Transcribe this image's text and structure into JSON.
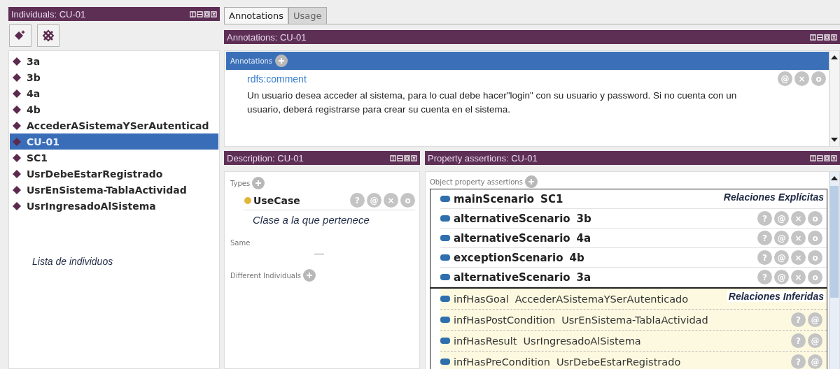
{
  "individuals": {
    "title": "Individuals: CU-01",
    "note": "Lista de individuos",
    "items": [
      {
        "label": "3a",
        "selected": false
      },
      {
        "label": "3b",
        "selected": false
      },
      {
        "label": "4a",
        "selected": false
      },
      {
        "label": "4b",
        "selected": false
      },
      {
        "label": "AccederASistemaYSerAutenticad",
        "selected": false
      },
      {
        "label": "CU-01",
        "selected": true
      },
      {
        "label": "SC1",
        "selected": false
      },
      {
        "label": "UsrDebeEstarRegistrado",
        "selected": false
      },
      {
        "label": "UsrEnSistema-TablaActividad",
        "selected": false
      },
      {
        "label": "UsrIngresadoAlSistema",
        "selected": false
      }
    ]
  },
  "tabs": [
    {
      "label": "Annotations",
      "selected": true
    },
    {
      "label": "Usage",
      "selected": false
    }
  ],
  "annotations": {
    "title": "Annotations: CU-01",
    "header": "Annotations",
    "property": "rdfs:comment",
    "actions": [
      "@",
      "×",
      "o"
    ],
    "text": "Un usuario desea acceder al sistema, para lo cual debe hacer\"login\" con su usuario y password. Si no cuenta con un usuario, deberá registrarse para crear su cuenta en el sistema."
  },
  "description": {
    "title": "Description: CU-01",
    "types_label": "Types",
    "type": "UseCase",
    "actions": [
      "?",
      "@",
      "×",
      "o"
    ],
    "note": "Clase a la que pertenece",
    "same_label": "Same",
    "different_label": "Different Individuals"
  },
  "property_assertions": {
    "title": "Property assertions: CU-01",
    "header": "Object property assertions",
    "groups": [
      {
        "kind": "explicit",
        "label": "Relaciones Explícitas",
        "rows": [
          {
            "property": "mainScenario",
            "value": "SC1"
          },
          {
            "property": "alternativeScenario",
            "value": "3b",
            "actions": [
              "?",
              "@",
              "×",
              "o"
            ]
          },
          {
            "property": "alternativeScenario",
            "value": "4a",
            "actions": [
              "?",
              "@",
              "×",
              "o"
            ]
          },
          {
            "property": "exceptionScenario",
            "value": "4b",
            "actions": [
              "?",
              "@",
              "×",
              "o"
            ]
          },
          {
            "property": "alternativeScenario",
            "value": "3a",
            "actions": [
              "?",
              "@",
              "×",
              "o"
            ]
          }
        ]
      },
      {
        "kind": "inferred",
        "label": "Relaciones Inferidas",
        "rows": [
          {
            "property": "infHasGoal",
            "value": "AccederASistemaYSerAutenticado"
          },
          {
            "property": "infHasPostCondition",
            "value": "UsrEnSistema-TablaActividad",
            "actions": [
              "?",
              "@"
            ]
          },
          {
            "property": "infHasResult",
            "value": "UsrIngresadoAlSistema",
            "actions": [
              "?",
              "@"
            ]
          },
          {
            "property": "infHasPreCondition",
            "value": "UsrDebeEstarRegistrado",
            "actions": [
              "?",
              "@"
            ]
          }
        ]
      }
    ]
  }
}
